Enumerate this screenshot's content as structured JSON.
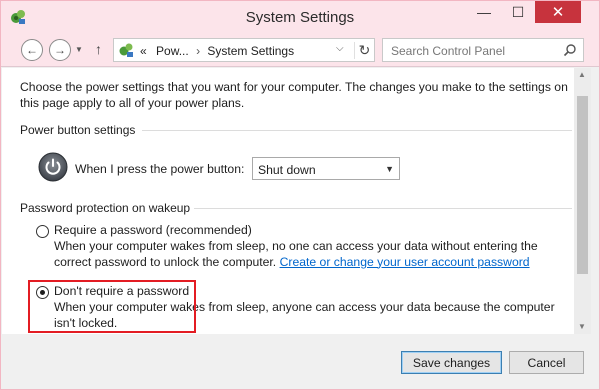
{
  "window": {
    "title": "System Settings",
    "controls": {
      "minimize": "—",
      "maximize": "☐",
      "close": "✕"
    },
    "accent_colors": {
      "titlebar": "#fce4ea",
      "close": "#c7333d",
      "link": "#0066cc",
      "highlight": "#e31c23"
    }
  },
  "nav": {
    "back_icon": "left-arrow-icon",
    "forward_icon": "right-arrow-icon",
    "up_icon": "up-arrow-icon",
    "dropdown_glyph": "▼",
    "up_glyph": "↑",
    "back_glyph": "←",
    "forward_glyph": "→",
    "breadcrumb": {
      "prefix": "«",
      "item1": "Pow...",
      "sep": "›",
      "item2": "System Settings"
    },
    "address_chevron": "⌵",
    "refresh_glyph": "↻",
    "search_placeholder": "Search Control Panel"
  },
  "content": {
    "intro": "Choose the power settings that you want for your computer. The changes you make to the settings on this page apply to all of your power plans.",
    "power_button_group": {
      "label": "Power button settings",
      "prompt": "When I press the power button:",
      "selected": "Shut down",
      "select_arrow": "▼"
    },
    "password_group": {
      "label": "Password protection on wakeup",
      "option1": {
        "title": "Require a password (recommended)",
        "desc_before_link": "When your computer wakes from sleep, no one can access your data without entering the correct password to unlock the computer. ",
        "link": "Create or change your user account password",
        "selected": false
      },
      "option2": {
        "title": "Don't require a password",
        "desc": "When your computer wakes from sleep, anyone can access your data because the computer isn't locked.",
        "selected": true
      }
    }
  },
  "scrollbar": {
    "up": "▲",
    "down": "▼"
  },
  "footer": {
    "save_label": "Save changes",
    "cancel_label": "Cancel"
  }
}
